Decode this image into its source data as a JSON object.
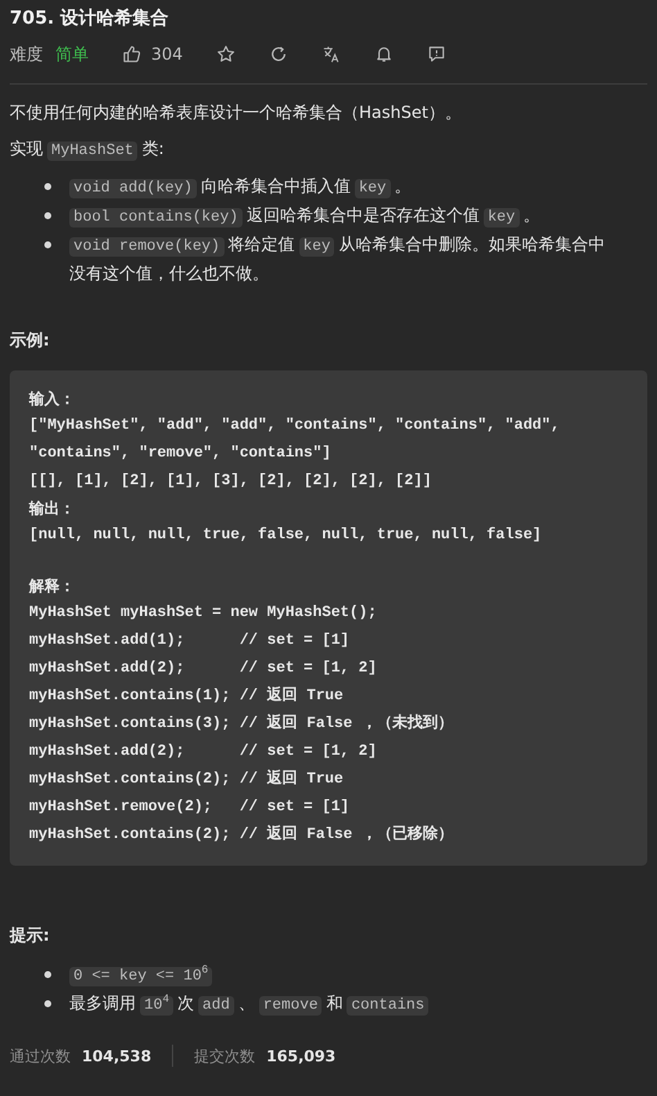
{
  "title": "705. 设计哈希集合",
  "meta": {
    "difficulty_label": "难度",
    "difficulty": "简单",
    "likes": "304"
  },
  "intro": [
    {
      "kind": "text",
      "text": "不使用任何内建的哈希表库设计一个哈希集合（HashSet）。"
    }
  ],
  "implement": [
    {
      "kind": "text",
      "text": "实现"
    },
    {
      "kind": "code",
      "text": "MyHashSet"
    },
    {
      "kind": "text",
      "text": "类:"
    }
  ],
  "methods": [
    [
      {
        "kind": "code",
        "text": "void add(key)"
      },
      {
        "kind": "text",
        "text": "向哈希集合中插入值"
      },
      {
        "kind": "code",
        "text": "key"
      },
      {
        "kind": "text",
        "text": "。"
      }
    ],
    [
      {
        "kind": "code",
        "text": "bool contains(key)"
      },
      {
        "kind": "text",
        "text": "返回哈希集合中是否存在这个值"
      },
      {
        "kind": "code",
        "text": "key"
      },
      {
        "kind": "text",
        "text": "。"
      }
    ],
    [
      {
        "kind": "code",
        "text": "void remove(key)"
      },
      {
        "kind": "text",
        "text": "将给定值"
      },
      {
        "kind": "code",
        "text": "key"
      },
      {
        "kind": "text",
        "text": "从哈希集合中删除。如果哈希集合中没有这个值，什么也不做。"
      }
    ]
  ],
  "example_heading": "示例:",
  "example": [
    {
      "kind": "label",
      "text": "输入："
    },
    {
      "kind": "code",
      "text": "[\"MyHashSet\", \"add\", \"add\", \"contains\", \"contains\", \"add\","
    },
    {
      "kind": "code",
      "text": "\"contains\", \"remove\", \"contains\"]"
    },
    {
      "kind": "code",
      "text": "[[], [1], [2], [1], [3], [2], [2], [2], [2]]"
    },
    {
      "kind": "label",
      "text": "输出："
    },
    {
      "kind": "code",
      "text": "[null, null, null, true, false, null, true, null, false]"
    },
    {
      "kind": "section",
      "text": "解释："
    },
    {
      "kind": "code",
      "text": "MyHashSet myHashSet = new MyHashSet();"
    },
    {
      "kind": "code",
      "text": "myHashSet.add(1);      // set = [1]"
    },
    {
      "kind": "code",
      "text": "myHashSet.add(2);      // set = [1, 2]"
    },
    {
      "kind": "code",
      "text": "myHashSet.contains(1); // 返回 True"
    },
    {
      "kind": "code",
      "text": "myHashSet.contains(3); // 返回 False ，（未找到）"
    },
    {
      "kind": "code",
      "text": "myHashSet.add(2);      // set = [1, 2]"
    },
    {
      "kind": "code",
      "text": "myHashSet.contains(2); // 返回 True"
    },
    {
      "kind": "code",
      "text": "myHashSet.remove(2);   // set = [1]"
    },
    {
      "kind": "code",
      "text": "myHashSet.contains(2); // 返回 False ，（已移除）"
    }
  ],
  "hints_heading": "提示:",
  "hints": [
    [
      {
        "kind": "code",
        "text": "0 <= key <= 10$^{6}$"
      }
    ],
    [
      {
        "kind": "text",
        "text": "最多调用"
      },
      {
        "kind": "code",
        "text": "10$^{4}$"
      },
      {
        "kind": "text",
        "text": "次"
      },
      {
        "kind": "code",
        "text": "add"
      },
      {
        "kind": "text",
        "text": "、"
      },
      {
        "kind": "code",
        "text": "remove"
      },
      {
        "kind": "text",
        "text": "和"
      },
      {
        "kind": "code",
        "text": "contains"
      }
    ]
  ],
  "stats": [
    {
      "label": "通过次数",
      "value": "104,538"
    },
    {
      "label": "提交次数",
      "value": "165,093"
    }
  ]
}
